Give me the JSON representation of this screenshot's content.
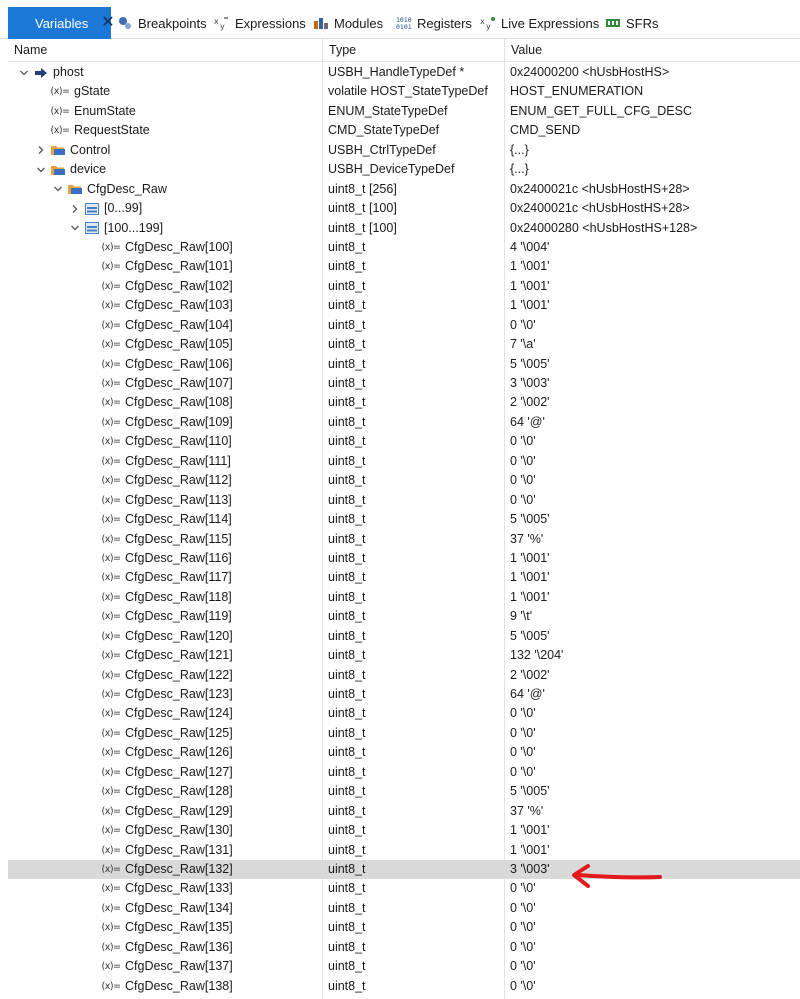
{
  "tabs": [
    {
      "label": "Variables",
      "icon": "variables-icon",
      "active": true
    },
    {
      "label": "Breakpoints",
      "icon": "breakpoints-icon",
      "active": false
    },
    {
      "label": "Expressions",
      "icon": "expressions-icon",
      "active": false
    },
    {
      "label": "Modules",
      "icon": "modules-icon",
      "active": false
    },
    {
      "label": "Registers",
      "icon": "registers-icon",
      "active": false
    },
    {
      "label": "Live Expressions",
      "icon": "live-expressions-icon",
      "active": false
    },
    {
      "label": "SFRs",
      "icon": "sfrs-icon",
      "active": false
    }
  ],
  "columns": {
    "name": "Name",
    "type": "Type",
    "value": "Value"
  },
  "rows": [
    {
      "name": "phost",
      "type": "USBH_HandleTypeDef *",
      "value": "0x24000200 <hUsbHostHS>",
      "level": 0,
      "twisty": "open",
      "icon": "pointer"
    },
    {
      "name": "gState",
      "type": "volatile HOST_StateTypeDef",
      "value": "HOST_ENUMERATION",
      "level": 1,
      "twisty": "none",
      "icon": "var"
    },
    {
      "name": "EnumState",
      "type": "ENUM_StateTypeDef",
      "value": "ENUM_GET_FULL_CFG_DESC",
      "level": 1,
      "twisty": "none",
      "icon": "var"
    },
    {
      "name": "RequestState",
      "type": "CMD_StateTypeDef",
      "value": "CMD_SEND",
      "level": 1,
      "twisty": "none",
      "icon": "var"
    },
    {
      "name": "Control",
      "type": "USBH_CtrlTypeDef",
      "value": "{...}",
      "level": 1,
      "twisty": "closed",
      "icon": "struct"
    },
    {
      "name": "device",
      "type": "USBH_DeviceTypeDef",
      "value": "{...}",
      "level": 1,
      "twisty": "open",
      "icon": "struct"
    },
    {
      "name": "CfgDesc_Raw",
      "type": "uint8_t [256]",
      "value": "0x2400021c <hUsbHostHS+28>",
      "level": 2,
      "twisty": "open",
      "icon": "struct"
    },
    {
      "name": "[0...99]",
      "type": "uint8_t [100]",
      "value": "0x2400021c <hUsbHostHS+28>",
      "level": 3,
      "twisty": "closed",
      "icon": "array"
    },
    {
      "name": "[100...199]",
      "type": "uint8_t [100]",
      "value": "0x24000280 <hUsbHostHS+128>",
      "level": 3,
      "twisty": "open",
      "icon": "array"
    },
    {
      "name": "CfgDesc_Raw[100]",
      "type": "uint8_t",
      "value": "4 '\\004'",
      "level": 4,
      "twisty": "none",
      "icon": "var"
    },
    {
      "name": "CfgDesc_Raw[101]",
      "type": "uint8_t",
      "value": "1 '\\001'",
      "level": 4,
      "twisty": "none",
      "icon": "var"
    },
    {
      "name": "CfgDesc_Raw[102]",
      "type": "uint8_t",
      "value": "1 '\\001'",
      "level": 4,
      "twisty": "none",
      "icon": "var"
    },
    {
      "name": "CfgDesc_Raw[103]",
      "type": "uint8_t",
      "value": "1 '\\001'",
      "level": 4,
      "twisty": "none",
      "icon": "var"
    },
    {
      "name": "CfgDesc_Raw[104]",
      "type": "uint8_t",
      "value": "0 '\\0'",
      "level": 4,
      "twisty": "none",
      "icon": "var"
    },
    {
      "name": "CfgDesc_Raw[105]",
      "type": "uint8_t",
      "value": "7 '\\a'",
      "level": 4,
      "twisty": "none",
      "icon": "var"
    },
    {
      "name": "CfgDesc_Raw[106]",
      "type": "uint8_t",
      "value": "5 '\\005'",
      "level": 4,
      "twisty": "none",
      "icon": "var"
    },
    {
      "name": "CfgDesc_Raw[107]",
      "type": "uint8_t",
      "value": "3 '\\003'",
      "level": 4,
      "twisty": "none",
      "icon": "var"
    },
    {
      "name": "CfgDesc_Raw[108]",
      "type": "uint8_t",
      "value": "2 '\\002'",
      "level": 4,
      "twisty": "none",
      "icon": "var"
    },
    {
      "name": "CfgDesc_Raw[109]",
      "type": "uint8_t",
      "value": "64 '@'",
      "level": 4,
      "twisty": "none",
      "icon": "var"
    },
    {
      "name": "CfgDesc_Raw[110]",
      "type": "uint8_t",
      "value": "0 '\\0'",
      "level": 4,
      "twisty": "none",
      "icon": "var"
    },
    {
      "name": "CfgDesc_Raw[111]",
      "type": "uint8_t",
      "value": "0 '\\0'",
      "level": 4,
      "twisty": "none",
      "icon": "var"
    },
    {
      "name": "CfgDesc_Raw[112]",
      "type": "uint8_t",
      "value": "0 '\\0'",
      "level": 4,
      "twisty": "none",
      "icon": "var"
    },
    {
      "name": "CfgDesc_Raw[113]",
      "type": "uint8_t",
      "value": "0 '\\0'",
      "level": 4,
      "twisty": "none",
      "icon": "var"
    },
    {
      "name": "CfgDesc_Raw[114]",
      "type": "uint8_t",
      "value": "5 '\\005'",
      "level": 4,
      "twisty": "none",
      "icon": "var"
    },
    {
      "name": "CfgDesc_Raw[115]",
      "type": "uint8_t",
      "value": "37 '%'",
      "level": 4,
      "twisty": "none",
      "icon": "var"
    },
    {
      "name": "CfgDesc_Raw[116]",
      "type": "uint8_t",
      "value": "1 '\\001'",
      "level": 4,
      "twisty": "none",
      "icon": "var"
    },
    {
      "name": "CfgDesc_Raw[117]",
      "type": "uint8_t",
      "value": "1 '\\001'",
      "level": 4,
      "twisty": "none",
      "icon": "var"
    },
    {
      "name": "CfgDesc_Raw[118]",
      "type": "uint8_t",
      "value": "1 '\\001'",
      "level": 4,
      "twisty": "none",
      "icon": "var"
    },
    {
      "name": "CfgDesc_Raw[119]",
      "type": "uint8_t",
      "value": "9 '\\t'",
      "level": 4,
      "twisty": "none",
      "icon": "var"
    },
    {
      "name": "CfgDesc_Raw[120]",
      "type": "uint8_t",
      "value": "5 '\\005'",
      "level": 4,
      "twisty": "none",
      "icon": "var"
    },
    {
      "name": "CfgDesc_Raw[121]",
      "type": "uint8_t",
      "value": "132 '\\204'",
      "level": 4,
      "twisty": "none",
      "icon": "var"
    },
    {
      "name": "CfgDesc_Raw[122]",
      "type": "uint8_t",
      "value": "2 '\\002'",
      "level": 4,
      "twisty": "none",
      "icon": "var"
    },
    {
      "name": "CfgDesc_Raw[123]",
      "type": "uint8_t",
      "value": "64 '@'",
      "level": 4,
      "twisty": "none",
      "icon": "var"
    },
    {
      "name": "CfgDesc_Raw[124]",
      "type": "uint8_t",
      "value": "0 '\\0'",
      "level": 4,
      "twisty": "none",
      "icon": "var"
    },
    {
      "name": "CfgDesc_Raw[125]",
      "type": "uint8_t",
      "value": "0 '\\0'",
      "level": 4,
      "twisty": "none",
      "icon": "var"
    },
    {
      "name": "CfgDesc_Raw[126]",
      "type": "uint8_t",
      "value": "0 '\\0'",
      "level": 4,
      "twisty": "none",
      "icon": "var"
    },
    {
      "name": "CfgDesc_Raw[127]",
      "type": "uint8_t",
      "value": "0 '\\0'",
      "level": 4,
      "twisty": "none",
      "icon": "var"
    },
    {
      "name": "CfgDesc_Raw[128]",
      "type": "uint8_t",
      "value": "5 '\\005'",
      "level": 4,
      "twisty": "none",
      "icon": "var"
    },
    {
      "name": "CfgDesc_Raw[129]",
      "type": "uint8_t",
      "value": "37 '%'",
      "level": 4,
      "twisty": "none",
      "icon": "var"
    },
    {
      "name": "CfgDesc_Raw[130]",
      "type": "uint8_t",
      "value": "1 '\\001'",
      "level": 4,
      "twisty": "none",
      "icon": "var"
    },
    {
      "name": "CfgDesc_Raw[131]",
      "type": "uint8_t",
      "value": "1 '\\001'",
      "level": 4,
      "twisty": "none",
      "icon": "var"
    },
    {
      "name": "CfgDesc_Raw[132]",
      "type": "uint8_t",
      "value": "3 '\\003'",
      "level": 4,
      "twisty": "none",
      "icon": "var",
      "selected": true
    },
    {
      "name": "CfgDesc_Raw[133]",
      "type": "uint8_t",
      "value": "0 '\\0'",
      "level": 4,
      "twisty": "none",
      "icon": "var"
    },
    {
      "name": "CfgDesc_Raw[134]",
      "type": "uint8_t",
      "value": "0 '\\0'",
      "level": 4,
      "twisty": "none",
      "icon": "var"
    },
    {
      "name": "CfgDesc_Raw[135]",
      "type": "uint8_t",
      "value": "0 '\\0'",
      "level": 4,
      "twisty": "none",
      "icon": "var"
    },
    {
      "name": "CfgDesc_Raw[136]",
      "type": "uint8_t",
      "value": "0 '\\0'",
      "level": 4,
      "twisty": "none",
      "icon": "var"
    },
    {
      "name": "CfgDesc_Raw[137]",
      "type": "uint8_t",
      "value": "0 '\\0'",
      "level": 4,
      "twisty": "none",
      "icon": "var"
    },
    {
      "name": "CfgDesc_Raw[138]",
      "type": "uint8_t",
      "value": "0 '\\0'",
      "level": 4,
      "twisty": "none",
      "icon": "var"
    }
  ],
  "colors": {
    "active_tab": "#1c78d7",
    "selected_row": "#d9d9d9",
    "annotation_arrow": "#e3191c",
    "struct_icon": "#e8a33c",
    "array_icon": "#4a7fc1"
  }
}
